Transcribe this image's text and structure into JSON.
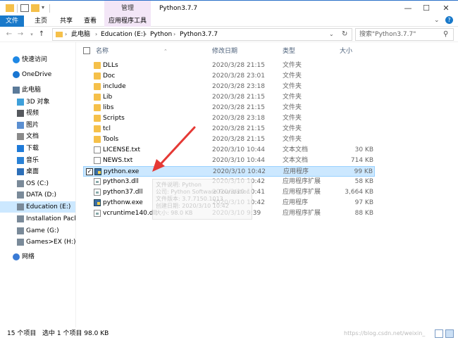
{
  "titlebar": {
    "context_tab": "管理",
    "title": "Python3.7.7",
    "minimize": "—",
    "maximize": "☐",
    "close": "✕"
  },
  "ribbon": {
    "tabs": [
      "文件",
      "主页",
      "共享",
      "查看",
      "应用程序工具"
    ],
    "help": "?"
  },
  "address": {
    "crumbs": [
      "此电脑",
      "Education (E:)",
      "Python",
      "Python3.7.7"
    ],
    "search_placeholder": "搜索\"Python3.7.7\""
  },
  "navpane": {
    "items": [
      {
        "label": "快速访问",
        "icon": "star-icon",
        "color": "#1e88e5"
      },
      {
        "label": "OneDrive",
        "icon": "cloud-icon",
        "color": "#1976d2"
      },
      {
        "label": "此电脑",
        "icon": "computer-icon",
        "color": "#5b7a99"
      },
      {
        "label": "3D 对象",
        "icon": "cube-icon",
        "color": "#3ea0da"
      },
      {
        "label": "视频",
        "icon": "video-icon",
        "color": "#55585d"
      },
      {
        "label": "图片",
        "icon": "picture-icon",
        "color": "#5b8fd1"
      },
      {
        "label": "文档",
        "icon": "document-icon",
        "color": "#8a8a8a"
      },
      {
        "label": "下载",
        "icon": "download-icon",
        "color": "#1e7ad8"
      },
      {
        "label": "音乐",
        "icon": "music-icon",
        "color": "#2a82d6"
      },
      {
        "label": "桌面",
        "icon": "desktop-icon",
        "color": "#2d6fb8"
      },
      {
        "label": "OS (C:)",
        "icon": "drive-icon",
        "color": "#7a8a99"
      },
      {
        "label": "DATA (D:)",
        "icon": "drive-icon",
        "color": "#7a8a99"
      },
      {
        "label": "Education (E:)",
        "icon": "drive-icon",
        "color": "#7a8a99"
      },
      {
        "label": "Installation Packag",
        "icon": "drive-icon",
        "color": "#7a8a99"
      },
      {
        "label": "Game (G:)",
        "icon": "drive-icon",
        "color": "#7a8a99"
      },
      {
        "label": "Games>EX (H:)",
        "icon": "drive-icon",
        "color": "#7a8a99"
      },
      {
        "label": "网络",
        "icon": "network-icon",
        "color": "#3a7bd5"
      }
    ]
  },
  "columns": {
    "name": "名称",
    "date": "修改日期",
    "type": "类型",
    "size": "大小"
  },
  "files": [
    {
      "name": "DLLs",
      "date": "2020/3/28 21:15",
      "type": "文件夹",
      "size": "",
      "kind": "folder"
    },
    {
      "name": "Doc",
      "date": "2020/3/28 23:01",
      "type": "文件夹",
      "size": "",
      "kind": "folder"
    },
    {
      "name": "include",
      "date": "2020/3/28 23:18",
      "type": "文件夹",
      "size": "",
      "kind": "folder"
    },
    {
      "name": "Lib",
      "date": "2020/3/28 21:15",
      "type": "文件夹",
      "size": "",
      "kind": "folder"
    },
    {
      "name": "libs",
      "date": "2020/3/28 21:15",
      "type": "文件夹",
      "size": "",
      "kind": "folder"
    },
    {
      "name": "Scripts",
      "date": "2020/3/28 23:18",
      "type": "文件夹",
      "size": "",
      "kind": "folder"
    },
    {
      "name": "tcl",
      "date": "2020/3/28 21:15",
      "type": "文件夹",
      "size": "",
      "kind": "folder"
    },
    {
      "name": "Tools",
      "date": "2020/3/28 21:15",
      "type": "文件夹",
      "size": "",
      "kind": "folder"
    },
    {
      "name": "LICENSE.txt",
      "date": "2020/3/10 10:44",
      "type": "文本文档",
      "size": "30 KB",
      "kind": "doc"
    },
    {
      "name": "NEWS.txt",
      "date": "2020/3/10 10:44",
      "type": "文本文档",
      "size": "714 KB",
      "kind": "doc"
    },
    {
      "name": "python.exe",
      "date": "2020/3/10 10:42",
      "type": "应用程序",
      "size": "99 KB",
      "kind": "exe",
      "selected": true
    },
    {
      "name": "python3.dll",
      "date": "2020/3/10 10:42",
      "type": "应用程序扩展",
      "size": "58 KB",
      "kind": "dll"
    },
    {
      "name": "python37.dll",
      "date": "2020/3/10 10:41",
      "type": "应用程序扩展",
      "size": "3,664 KB",
      "kind": "dll"
    },
    {
      "name": "pythonw.exe",
      "date": "2020/3/10 10:42",
      "type": "应用程序",
      "size": "97 KB",
      "kind": "exe"
    },
    {
      "name": "vcruntime140.dll",
      "date": "2020/3/10 9:39",
      "type": "应用程序扩展",
      "size": "88 KB",
      "kind": "dll"
    }
  ],
  "tooltip": [
    "文件说明: Python",
    "公司: Python Software Foundation",
    "文件版本: 3.7.7150.1013",
    "创建日期: 2020/3/10 10:42",
    "大小: 98.0 KB"
  ],
  "status": {
    "count": "15 个项目",
    "selection": "选中 1 个项目  98.0 KB",
    "watermark": "https://blog.csdn.net/weixin_"
  },
  "colors": {
    "accent": "#1979ca",
    "selection": "#cce8ff",
    "context_tab": "#f3e6f7",
    "arrow": "#e53935"
  }
}
